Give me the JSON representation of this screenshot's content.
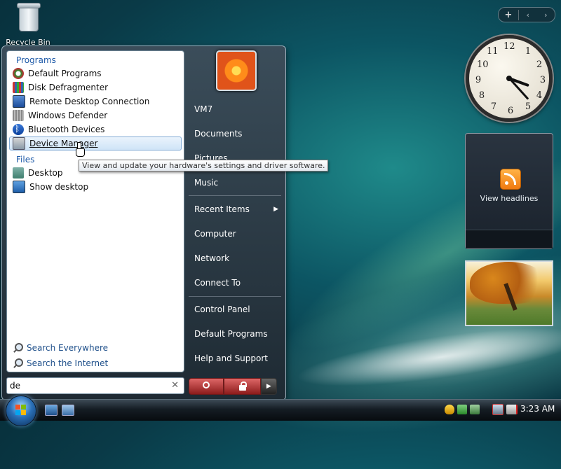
{
  "desktop": {
    "recycle_bin_label": "Recycle Bin"
  },
  "gadgets": {
    "toolbar": {
      "add_symbol": "+",
      "prev_symbol": "‹",
      "next_symbol": "›"
    },
    "clock_numbers": [
      "12",
      "1",
      "2",
      "3",
      "4",
      "5",
      "6",
      "7",
      "8",
      "9",
      "10",
      "11"
    ],
    "feed_text": "View headlines"
  },
  "start_menu": {
    "programs_header": "Programs",
    "programs": [
      {
        "label": "Default Programs",
        "icon": "default-programs-icon"
      },
      {
        "label": "Disk Defragmenter",
        "icon": "disk-defragmenter-icon"
      },
      {
        "label": "Remote Desktop Connection",
        "icon": "remote-desktop-icon"
      },
      {
        "label": "Windows Defender",
        "icon": "windows-defender-icon"
      },
      {
        "label": "Bluetooth Devices",
        "icon": "bluetooth-icon"
      },
      {
        "label": "Device Manager",
        "icon": "device-manager-icon"
      }
    ],
    "files_header": "Files",
    "files": [
      {
        "label": "Desktop",
        "icon": "desktop-folder-icon"
      },
      {
        "label": "Show desktop",
        "icon": "show-desktop-icon"
      }
    ],
    "search_everywhere": "Search Everywhere",
    "search_internet": "Search the Internet",
    "search_value": "de",
    "clear_symbol": "✕",
    "tooltip": "View and update your hardware's settings and driver software.",
    "right_items": {
      "user": "VM7",
      "documents": "Documents",
      "pictures": "Pictures",
      "music": "Music",
      "recent": "Recent Items",
      "computer": "Computer",
      "network": "Network",
      "connect": "Connect To",
      "control_panel": "Control Panel",
      "default_programs": "Default Programs",
      "help": "Help and Support"
    },
    "arrow_symbol": "▶"
  },
  "taskbar": {
    "time": "3:23 AM"
  }
}
